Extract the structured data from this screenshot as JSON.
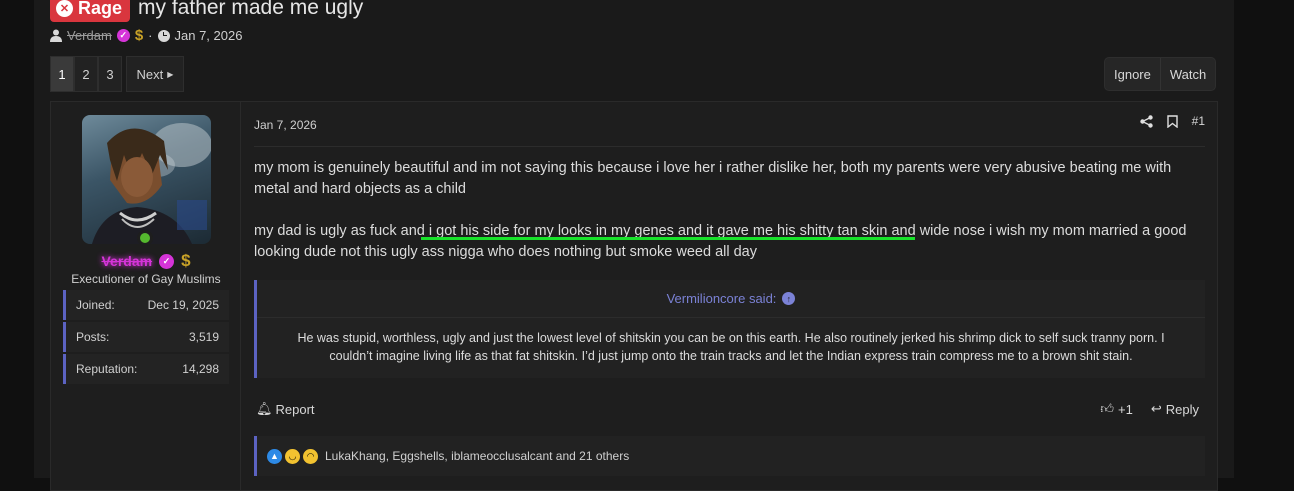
{
  "thread": {
    "prefix": "Rage",
    "title": "my father made me ugly",
    "author": "Verdam",
    "date": "Jan 7, 2026"
  },
  "pagination": {
    "pages": [
      "1",
      "2",
      "3"
    ],
    "active": "1",
    "next_label": "Next"
  },
  "thread_actions": {
    "ignore_label": "Ignore",
    "watch_label": "Watch"
  },
  "post": {
    "user": {
      "name": "Verdam",
      "title": "Executioner of Gay Muslims",
      "online": true,
      "stats": [
        {
          "label": "Joined:",
          "value": "Dec 19, 2025"
        },
        {
          "label": "Posts:",
          "value": "3,519"
        },
        {
          "label": "Reputation:",
          "value": "14,298"
        }
      ]
    },
    "date": "Jan 7, 2026",
    "number": "#1",
    "paragraphs": [
      "my mom is genuinely beautiful and im not saying this because i love her i rather dislike her, both my parents were very abusive beating me with metal and hard objects as a child",
      "my dad is ugly as fuck and i got his side for my looks in my genes and it gave me his shitty tan skin and wide nose i wish my mom married a good looking dude not this ugly ass nigga who does nothing but smoke weed all day"
    ],
    "quote": {
      "author_line": "Vermilioncore said:",
      "text": "He was stupid, worthless, ugly and just the lowest level of shitskin you can be on this earth. He also routinely jerked his shrimp dick to self suck tranny porn. I couldn’t imagine living life as that fat shitskin. I’d just jump onto the train tracks and let the Indian express train compress me to a brown shit stain."
    },
    "report_label": "Report",
    "like_count": "+1",
    "reply_label": "Reply",
    "reactions_text": "LukaKhang, Eggshells, iblameocclusalcant and 21 others"
  },
  "colors": {
    "accent": "#5c63c2",
    "prefix": "#d9363e",
    "username": "#d534d8",
    "highlight": "#18e22a"
  }
}
